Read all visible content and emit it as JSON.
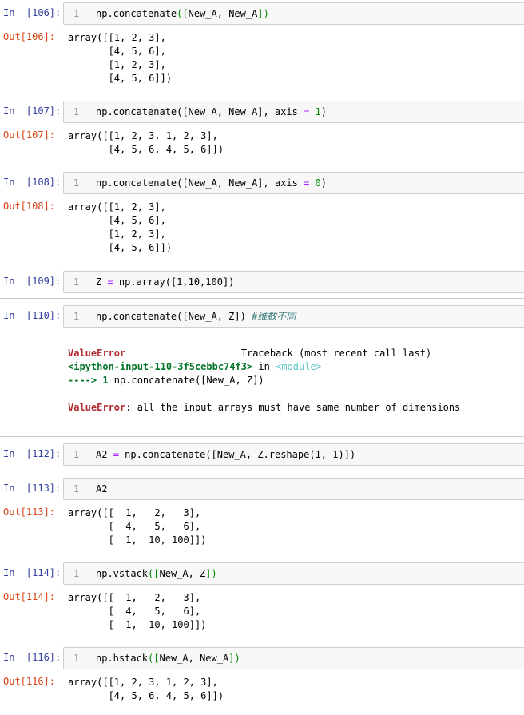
{
  "cells": [
    {
      "in": "In  [106]:",
      "code": "np.concatenate([New_A, New_A])",
      "out": "Out[106]:",
      "output": [
        "array([[1, 2, 3],",
        "       [4, 5, 6],",
        "       [1, 2, 3],",
        "       [4, 5, 6]])"
      ]
    },
    {
      "in": "In  [107]:",
      "code_a": "np.concatenate([New_A, New_A], axis ",
      "code_op": "=",
      "code_num": " 1",
      "code_b": ")",
      "out": "Out[107]:",
      "output": [
        "array([[1, 2, 3, 1, 2, 3],",
        "       [4, 5, 6, 4, 5, 6]])"
      ]
    },
    {
      "in": "In  [108]:",
      "code_a": "np.concatenate([New_A, New_A], axis ",
      "code_op": "=",
      "code_num": " 0",
      "code_b": ")",
      "out": "Out[108]:",
      "output": [
        "array([[1, 2, 3],",
        "       [4, 5, 6],",
        "       [1, 2, 3],",
        "       [4, 5, 6]])"
      ]
    },
    {
      "in": "In  [109]:",
      "code_a": "Z ",
      "code_op": "=",
      "code_b": " np.array([1,10,100])"
    },
    {
      "in": "In  [110]:",
      "code": "np.concatenate([New_A, Z]) ",
      "comment": "#维数不同",
      "error": {
        "name": "ValueError",
        "traceback": "Traceback (most recent call last)",
        "location": "<ipython-input-110-3f5cebbc74f3>",
        "in_word": " in ",
        "module": "<module>",
        "arrow": "---->",
        "line_no": " 1",
        "line_code": " np.concatenate([New_A, Z])",
        "message_name": "ValueError",
        "message": ": all the input arrays must have same number of dimensions"
      }
    },
    {
      "in": "In  [112]:",
      "code_a": "A2 ",
      "code_op": "=",
      "code_b": " np.concatenate([New_A, Z.reshape(1,",
      "code_op2": "-",
      "code_c": "1)])"
    },
    {
      "in": "In  [113]:",
      "code": "A2",
      "out": "Out[113]:",
      "output": [
        "array([[  1,   2,   3],",
        "       [  4,   5,   6],",
        "       [  1,  10, 100]])"
      ]
    },
    {
      "in": "In  [114]:",
      "code": "np.vstack([New_A, Z])",
      "out": "Out[114]:",
      "output": [
        "array([[  1,   2,   3],",
        "       [  4,   5,   6],",
        "       [  1,  10, 100]])"
      ]
    },
    {
      "in": "In  [116]:",
      "code": "np.hstack([New_A, New_A])",
      "out": "Out[116]:",
      "output": [
        "array([[1, 2, 3, 1, 2, 3],",
        "       [4, 5, 6, 4, 5, 6]])"
      ]
    }
  ],
  "line_number": "1"
}
